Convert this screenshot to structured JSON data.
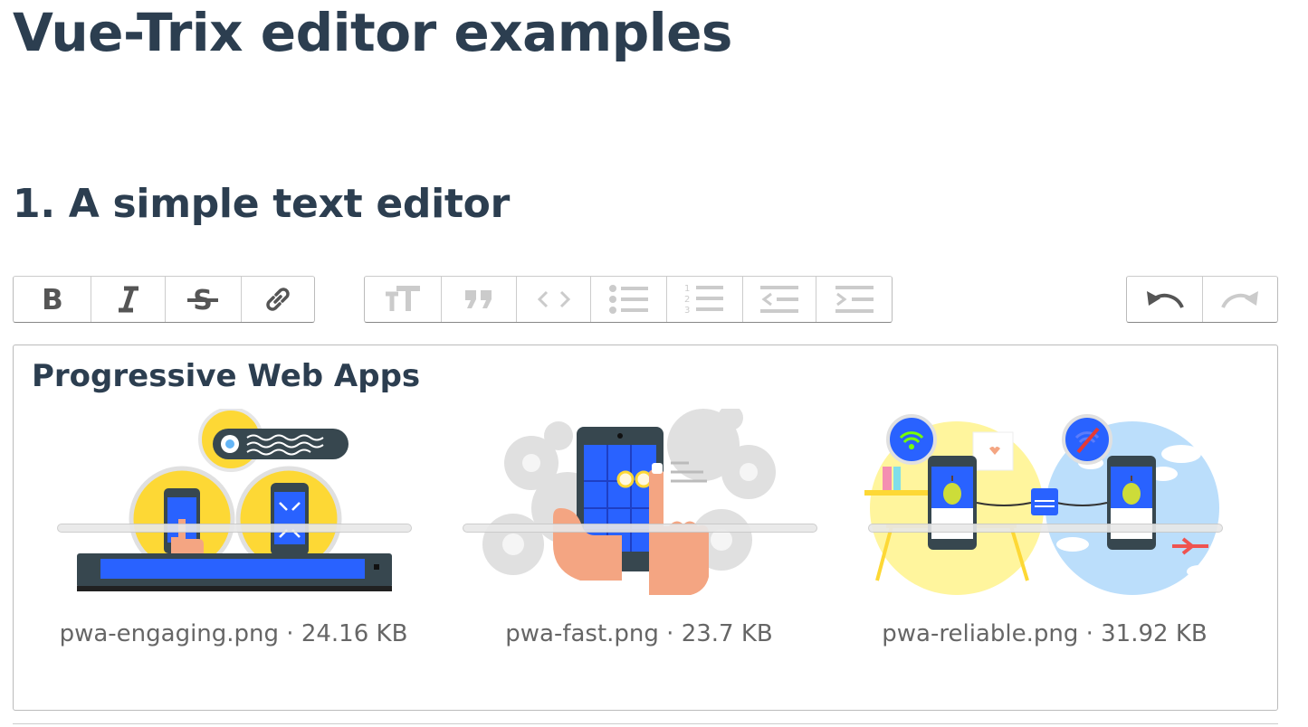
{
  "page": {
    "title": "Vue-Trix editor examples"
  },
  "section": {
    "title": "1. A simple text editor"
  },
  "toolbar": {
    "text_tools": [
      {
        "name": "bold",
        "label": "Bold",
        "icon": "bold-icon"
      },
      {
        "name": "italic",
        "label": "Italic",
        "icon": "italic-icon"
      },
      {
        "name": "strike",
        "label": "Strikethrough",
        "icon": "strikethrough-icon"
      },
      {
        "name": "link",
        "label": "Link",
        "icon": "link-icon"
      }
    ],
    "block_tools": [
      {
        "name": "heading",
        "label": "Heading",
        "icon": "heading-icon"
      },
      {
        "name": "quote",
        "label": "Quote",
        "icon": "quote-icon"
      },
      {
        "name": "code",
        "label": "Code",
        "icon": "code-icon"
      },
      {
        "name": "bullets",
        "label": "Bullets",
        "icon": "bullet-list-icon"
      },
      {
        "name": "numbers",
        "label": "Numbers",
        "icon": "number-list-icon"
      },
      {
        "name": "outdent",
        "label": "Decrease Level",
        "icon": "outdent-icon"
      },
      {
        "name": "indent",
        "label": "Increase Level",
        "icon": "indent-icon"
      }
    ],
    "history_tools": [
      {
        "name": "undo",
        "label": "Undo",
        "icon": "undo-icon"
      },
      {
        "name": "redo",
        "label": "Redo",
        "icon": "redo-icon"
      }
    ]
  },
  "editor": {
    "heading": "Progressive Web Apps",
    "attachments": [
      {
        "filename": "pwa-engaging.png",
        "size": "24.16 KB",
        "caption": "pwa-engaging.png · 24.16 KB",
        "upload_progress": 0.0
      },
      {
        "filename": "pwa-fast.png",
        "size": "23.7 KB",
        "caption": "pwa-fast.png · 23.7 KB",
        "upload_progress": 0.0
      },
      {
        "filename": "pwa-reliable.png",
        "size": "31.92 KB",
        "caption": "pwa-reliable.png · 31.92 KB",
        "upload_progress": 0.0
      }
    ]
  },
  "colors": {
    "text": "#2c3e50",
    "yellow": "#fdd835",
    "blue": "#2962ff",
    "skin": "#f4a582",
    "light_blue": "#bbdefb"
  }
}
